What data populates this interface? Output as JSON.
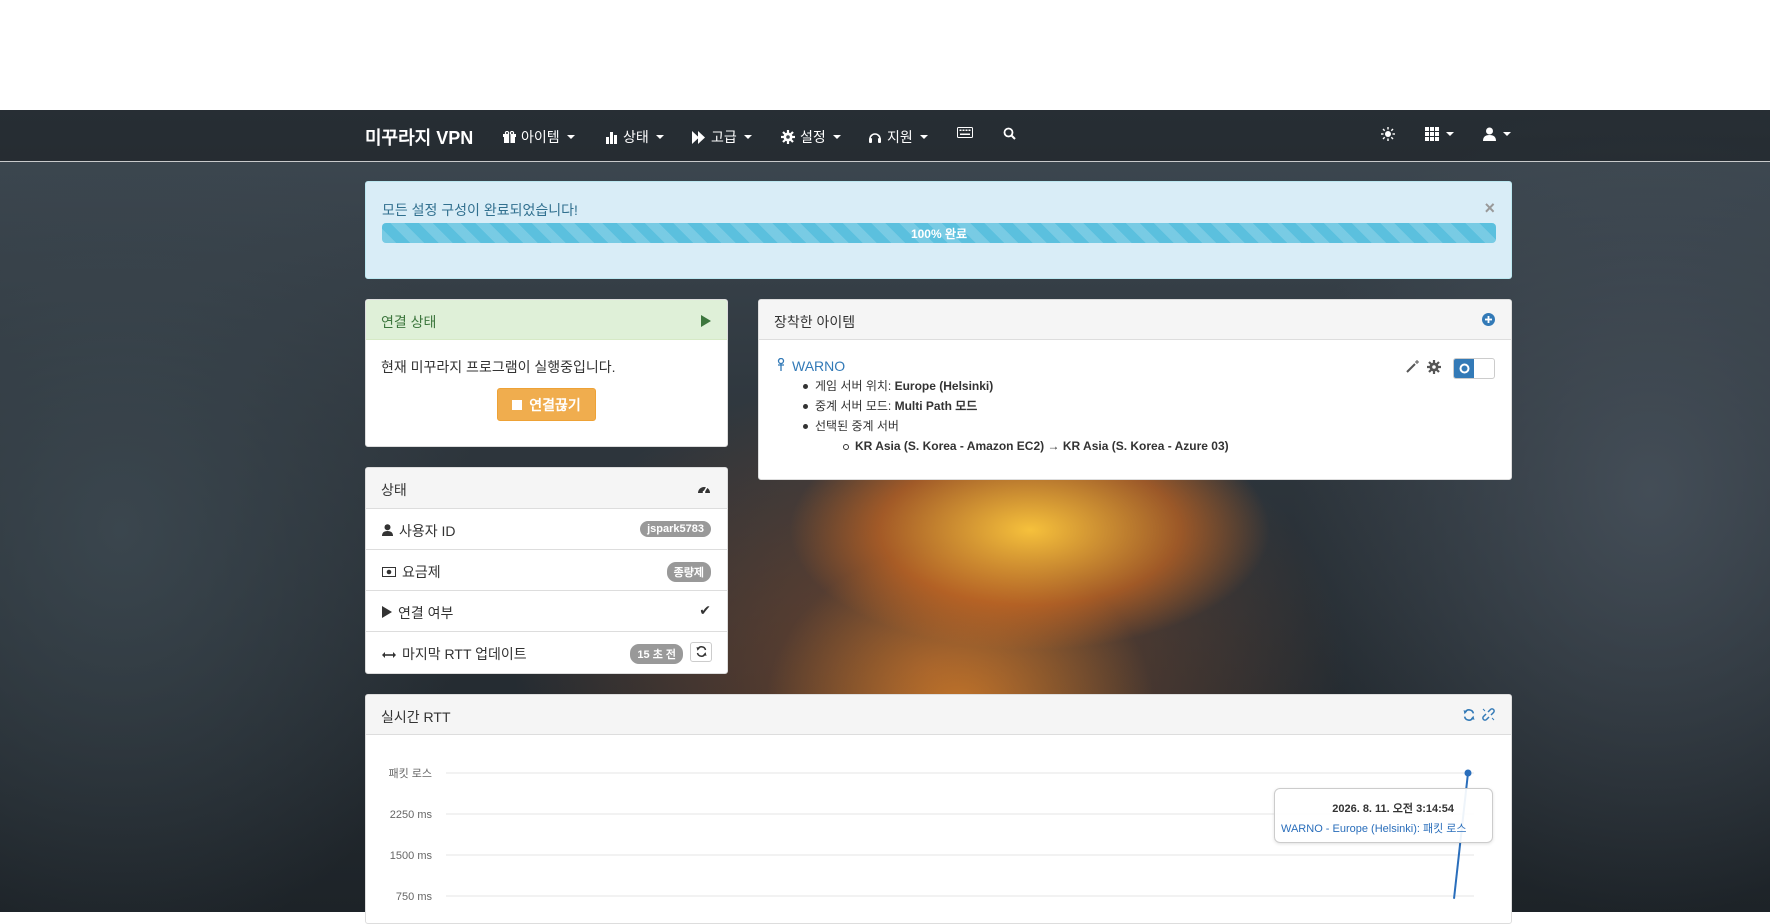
{
  "navbar": {
    "brand": "미꾸라지 VPN",
    "menus": [
      {
        "label": "아이템",
        "icon": "gift-icon"
      },
      {
        "label": "상태",
        "icon": "bar-chart-icon"
      },
      {
        "label": "고급",
        "icon": "fast-forward-icon"
      },
      {
        "label": "설정",
        "icon": "gear-icon"
      },
      {
        "label": "지원",
        "icon": "headset-icon"
      }
    ],
    "right_icons": [
      "sun-icon",
      "apps-grid-icon",
      "user-icon"
    ]
  },
  "alert": {
    "message": "모든 설정 구성이 완료되었습니다!",
    "close": "×",
    "progress_percent": 100,
    "progress_label": "100% 완료"
  },
  "connection_panel": {
    "title": "연결 상태",
    "status_text": "현재 미꾸라지 프로그램이 실행중입니다.",
    "disconnect_label": "연결끊기"
  },
  "status_panel": {
    "title": "상태",
    "rows": [
      {
        "label": "사용자 ID",
        "value": "jspark5783"
      },
      {
        "label": "요금제",
        "value": "종량제"
      },
      {
        "label": "연결 여부",
        "value": "✔"
      },
      {
        "label": "마지막 RTT 업데이트",
        "value": "15 초 전"
      }
    ]
  },
  "equipped_panel": {
    "title": "장착한 아이템",
    "item": {
      "name": "WARNO",
      "game_server_label": "게임 서버 위치: ",
      "game_server_value": "Europe (Helsinki)",
      "relay_mode_label": "중계 서버 모드: ",
      "relay_mode_value": "Multi Path 모드",
      "selected_relay_label": "선택된 중계 서버",
      "selected_relay_value": "KR Asia (S. Korea - Amazon EC2) → KR Asia (S. Korea - Azure 03)"
    }
  },
  "rtt_panel": {
    "title": "실시간 RTT",
    "tooltip": {
      "time": "2026. 8. 11. 오전 3:14:54",
      "series_text": "WARNO - Europe (Helsinki): 패킷 로스"
    }
  },
  "chart_data": {
    "type": "line",
    "ytick_labels": [
      "패킷 로스",
      "2250 ms",
      "1500 ms",
      "750 ms"
    ],
    "series": [
      {
        "name": "WARNO - Europe (Helsinki)",
        "values": [
          700,
          3000
        ],
        "color": "#2a6ebb"
      }
    ]
  }
}
